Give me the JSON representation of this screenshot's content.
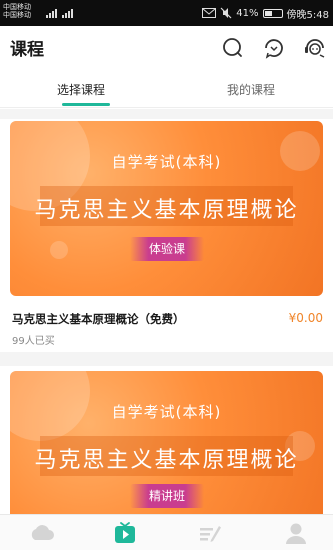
{
  "status_bar": {
    "carrier_1": "中国移动",
    "carrier_2": "中国移动",
    "battery_percent": "41%",
    "time": "傍晚5:48"
  },
  "header": {
    "title": "课程",
    "icons": [
      "search-icon",
      "refresh-chat-icon",
      "customer-service-icon"
    ]
  },
  "tabs": [
    {
      "label": "选择课程",
      "active": true
    },
    {
      "label": "我的课程",
      "active": false
    }
  ],
  "colors": {
    "accent": "#1fb89a",
    "price": "#f0852a",
    "banner": "#ff8e3a"
  },
  "courses": [
    {
      "banner_subtitle": "自学考试(本科)",
      "banner_title": "马克思主义基本原理概论",
      "banner_badge": "体验课",
      "name": "马克思主义基本原理概论（免费）",
      "price": "¥0.00",
      "buyers": "99人已买"
    },
    {
      "banner_subtitle": "自学考试(本科)",
      "banner_title": "马克思主义基本原理概论",
      "banner_badge": "精讲班"
    }
  ],
  "bottom_nav": [
    "home-icon",
    "course-icon",
    "practice-icon",
    "profile-icon"
  ]
}
